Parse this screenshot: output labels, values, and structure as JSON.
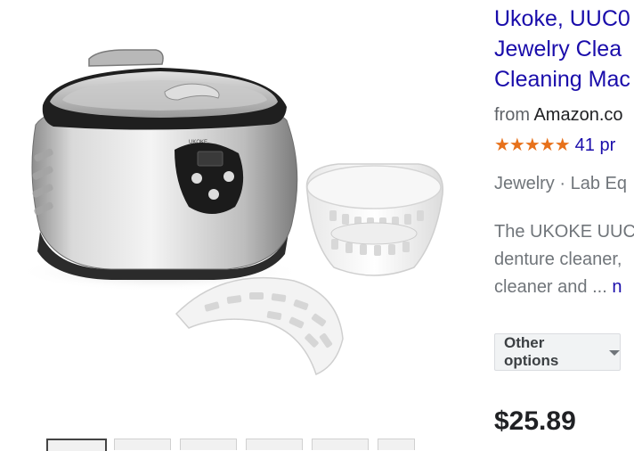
{
  "product": {
    "title": "Ukoke, UUC0\nJewelry Clea\nCleaning Mac",
    "seller_prefix": "from ",
    "seller_name": "Amazon.co",
    "stars": "★★★★★",
    "rating_count": "41 pr",
    "category": "Jewelry · Lab Eq",
    "description": "The UKOKE UUC\ndenture cleaner,\ncleaner and ...",
    "more_link": "n",
    "other_options_label": "Other options",
    "price": "$25.89"
  },
  "colors": {
    "link": "#1a0dab",
    "star": "#e7711b"
  }
}
